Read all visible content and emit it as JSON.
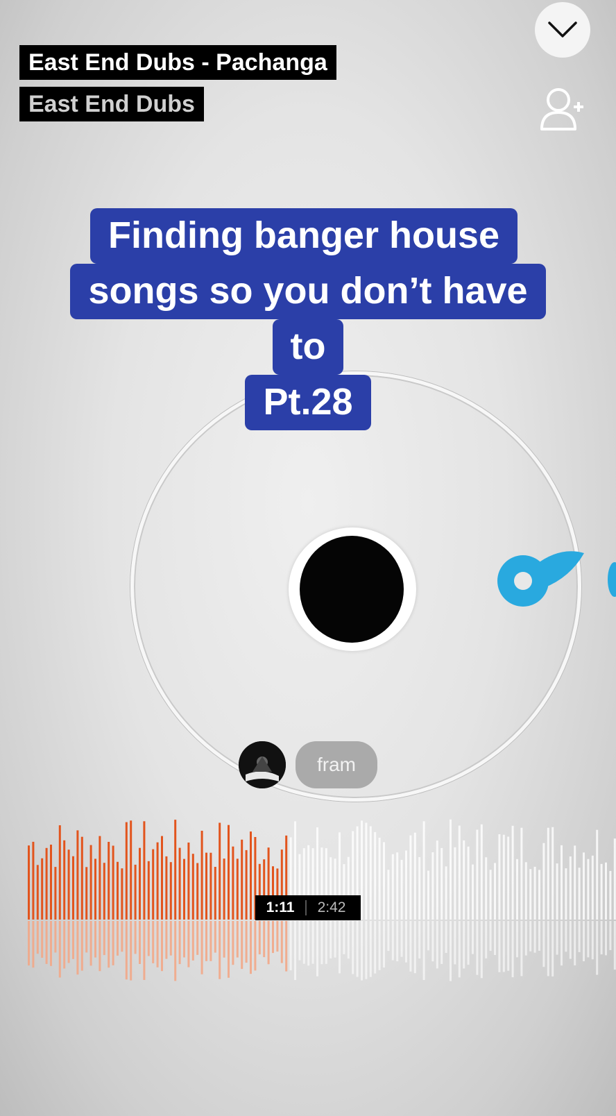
{
  "track": {
    "title": "East End Dubs - Pachanga",
    "artist": "East End Dubs"
  },
  "controls": {
    "collapse_icon": "chevron-down-icon",
    "follow_icon": "person-add-icon"
  },
  "caption": {
    "lines": [
      "Finding banger house",
      "songs so you don’t have",
      "to",
      "Pt.28"
    ],
    "color": "#2b3fa8"
  },
  "user": {
    "name": "fram"
  },
  "player": {
    "current_time": "1:11",
    "total_time": "2:42",
    "progress": 0.44,
    "played_color": "#e2541d",
    "unplayed_color": "#ffffff"
  }
}
